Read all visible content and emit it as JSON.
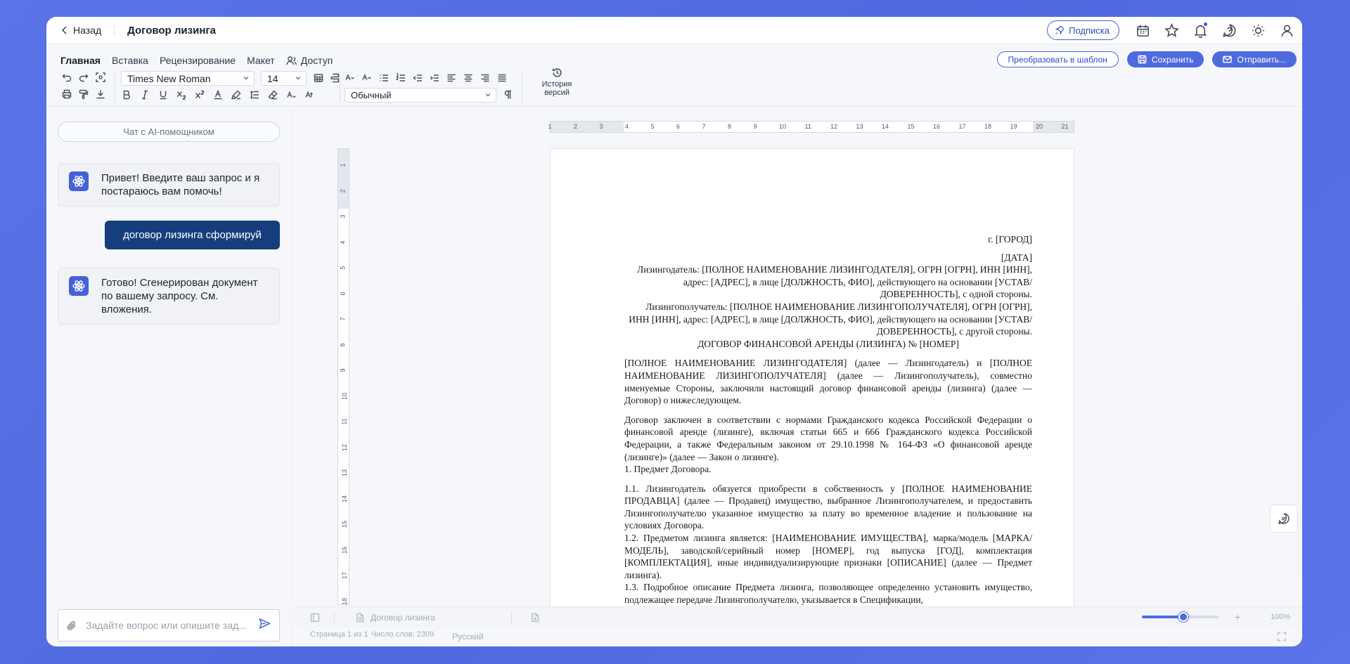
{
  "header": {
    "back_label": "Назад",
    "doc_title": "Договор лизинга",
    "subscription_label": "Подписка"
  },
  "ribbon": {
    "tabs": [
      "Главная",
      "Вставка",
      "Рецензирование",
      "Макет",
      "Доступ"
    ],
    "font_family": "Times New Roman",
    "font_size": "14",
    "style": "Обычный",
    "history_line1": "История",
    "history_line2": "версий",
    "to_template_label": "Преобразовать в шаблон",
    "save_label": "Сохранить",
    "send_label": "Отправить..."
  },
  "chat": {
    "chip_label": "Чат с AI-помощником",
    "messages": [
      {
        "role": "bot",
        "text": "Привет! Введите ваш запрос и я постараюсь вам помочь!"
      },
      {
        "role": "user",
        "text": "договор лизинга сформируй"
      },
      {
        "role": "bot",
        "text": "Готово! Сгенерирован документ по вашему запросу. См. вложения."
      }
    ],
    "input_placeholder": "Задайте вопрос или опишите зад..."
  },
  "document": {
    "city": "г. [ГОРОД]",
    "date": "[ДАТА]",
    "lessor": "Лизингодатель: [ПОЛНОЕ НАИМЕНОВАНИЕ ЛИЗИНГОДАТЕЛЯ], ОГРН [ОГРН], ИНН [ИНН], адрес: [АДРЕС], в лице [ДОЛЖНОСТЬ, ФИО], действующего на основании [УСТАВ/ДОВЕРЕННОСТЬ], с одной стороны.",
    "lessee": "Лизингополучатель: [ПОЛНОЕ НАИМЕНОВАНИЕ ЛИЗИНГОПОЛУЧАТЕЛЯ], ОГРН [ОГРН], ИНН [ИНН], адрес: [АДРЕС], в лице [ДОЛЖНОСТЬ, ФИО], действующего на основании [УСТАВ/ДОВЕРЕННОСТЬ], с другой стороны.",
    "heading": "ДОГОВОР ФИНАНСОВОЙ АРЕНДЫ (ЛИЗИНГА) № [НОМЕР]",
    "intro": "[ПОЛНОЕ НАИМЕНОВАНИЕ ЛИЗИНГОДАТЕЛЯ] (далее — Лизингодатель) и [ПОЛНОЕ НАИМЕНОВАНИЕ ЛИЗИНГОПОЛУЧАТЕЛЯ] (далее — Лизингополучатель), совместно именуемые Стороны, заключили настоящий договор финансовой аренды (лизинга) (далее — Договор) о нижеследующем.",
    "legal_basis": "Договор заключен в соответствии с нормами Гражданского кодекса Российской Федерации о финансовой аренде (лизинге), включая статьи 665 и 666 Гражданского кодекса Российской Федерации, а также Федеральным законом от 29.10.1998 № 164-ФЗ «О финансовой аренде (лизинге)» (далее — Закон о лизинге).",
    "section1": "1. Предмет Договора.",
    "p1_1": "1.1. Лизингодатель обязуется приобрести в собственность у [ПОЛНОЕ НАИМЕНОВАНИЕ ПРОДАВЦА] (далее — Продавец) имущество, выбранное Лизингополучателем, и предоставить Лизингополучателю указанное имущество за плату во временное владение и пользование на условиях Договора.",
    "p1_2": "1.2. Предметом лизинга является: [НАИМЕНОВАНИЕ ИМУЩЕСТВА], марка/модель [МАРКА/МОДЕЛЬ], заводской/серийный номер [НОМЕР], год выпуска [ГОД], комплектация [КОМПЛЕКТАЦИЯ], иные индивидуализирующие признаки [ОПИСАНИЕ] (далее — Предмет лизинга).",
    "p1_3": "1.3. Подробное описание Предмета лизинга, позволяющее определенно установить имущество, подлежащее передаче Лизингополучателю, указывается в Спецификации,"
  },
  "statusbar": {
    "doc_name": "Договор лизинга",
    "zoom": "100%",
    "zoom_level": 0.54,
    "page_info": "Страница 1 из 1",
    "word_count": "Число слов: 2309",
    "language": "Русский"
  }
}
